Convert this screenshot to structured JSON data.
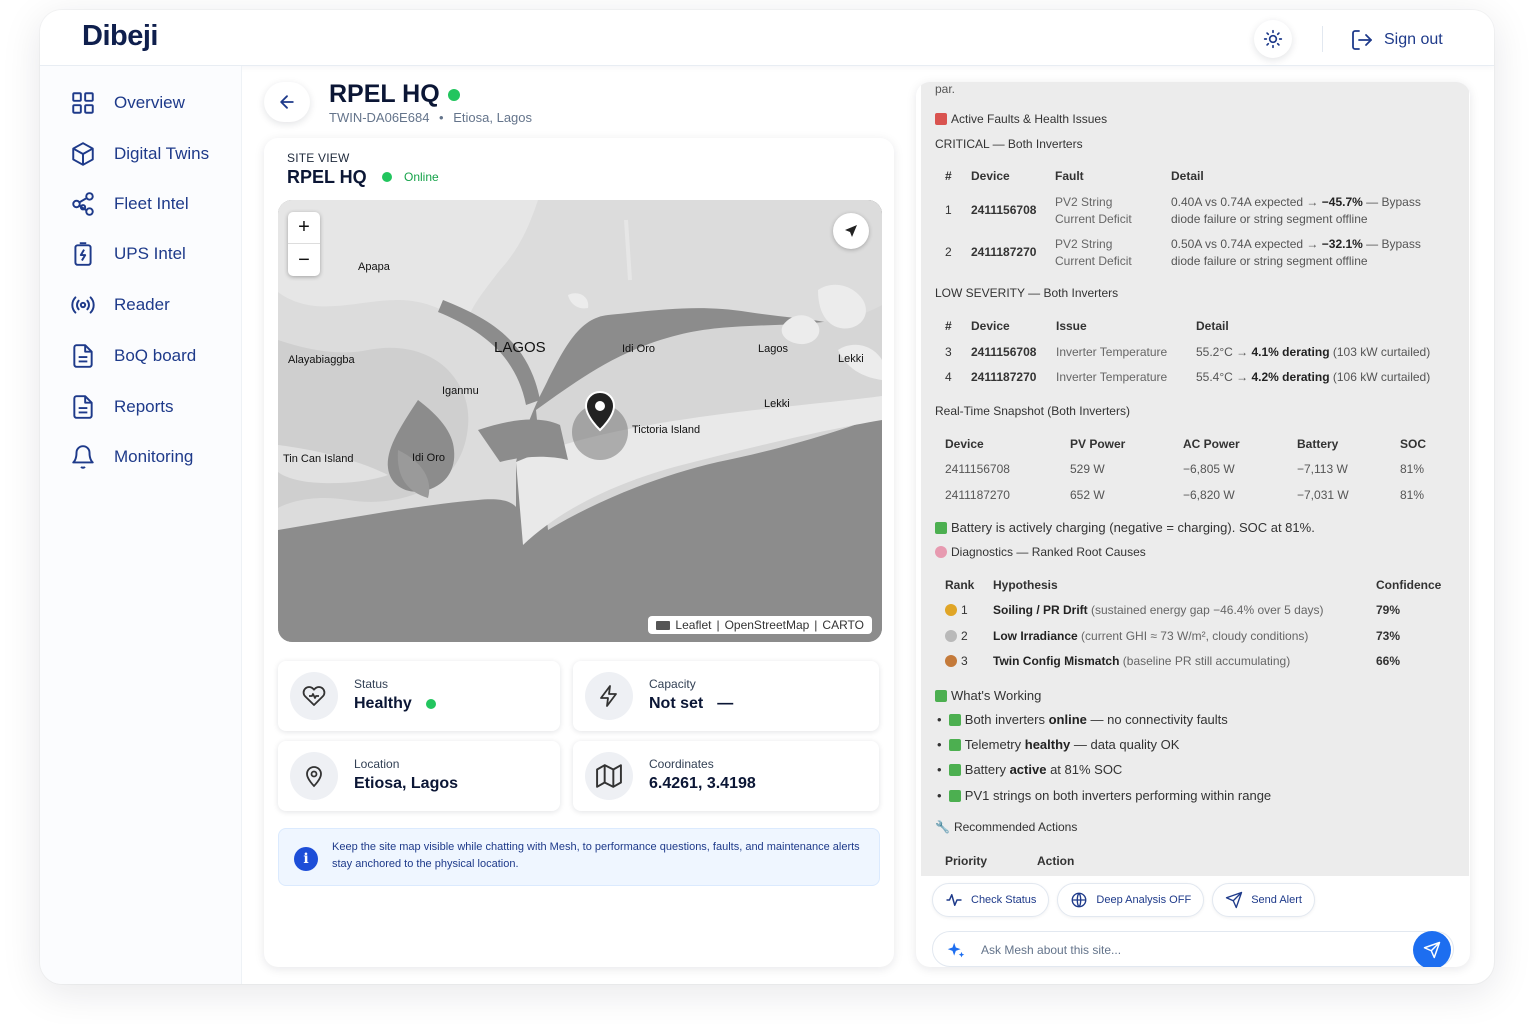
{
  "app": {
    "logo": "Dibeji",
    "sign_out": "Sign out"
  },
  "sidebar": {
    "items": [
      {
        "label": "Overview",
        "icon": "grid-icon"
      },
      {
        "label": "Digital Twins",
        "icon": "cube-icon"
      },
      {
        "label": "Fleet Intel",
        "icon": "network-icon"
      },
      {
        "label": "UPS Intel",
        "icon": "battery-bolt-icon"
      },
      {
        "label": "Reader",
        "icon": "broadcast-icon"
      },
      {
        "label": "BoQ board",
        "icon": "document-icon"
      },
      {
        "label": "Reports",
        "icon": "document-icon"
      },
      {
        "label": "Monitoring",
        "icon": "bell-icon"
      }
    ]
  },
  "header": {
    "title": "RPEL HQ",
    "twin_id": "TWIN-DA06E684",
    "separator": "•",
    "location": "Etiosa, Lagos"
  },
  "site": {
    "label": "SITE VIEW",
    "title": "RPEL HQ",
    "status": "Online",
    "map": {
      "attribution": {
        "leaflet": "Leaflet",
        "sep": "|",
        "osm": "OpenStreetMap",
        "carto": "CARTO"
      },
      "labels": [
        "Apapa",
        "LAGOS",
        "Idi Oro",
        "Lagos",
        "Lekki",
        "Alayabiaggba",
        "Iganmu",
        "Lekki",
        "Tictoria Island",
        "Tin Can Island",
        "Idi Oro"
      ]
    },
    "tiles": {
      "status": {
        "label": "Status",
        "value": "Healthy"
      },
      "capacity": {
        "label": "Capacity",
        "value": "Not set",
        "dash": "—"
      },
      "location": {
        "label": "Location",
        "value": "Etiosa, Lagos"
      },
      "coordinates": {
        "label": "Coordinates",
        "value": "6.4261, 3.4198"
      }
    },
    "info": "Keep the site map visible while chatting with Mesh, to performance questions, faults, and maintenance alerts stay anchored to the physical location."
  },
  "chat": {
    "cut_top": "par.",
    "faults_heading": "Active Faults & Health Issues",
    "critical_heading": "CRITICAL — Both Inverters",
    "critical_headers": [
      "#",
      "Device",
      "Fault",
      "Detail"
    ],
    "critical_rows": [
      {
        "n": "1",
        "device": "2411156708",
        "fault1": "PV2 String",
        "fault2": "Current Deficit",
        "d1": "0.40A vs 0.74A expected → ",
        "d_bold": "−45.7%",
        "d2": " — Bypass",
        "d3": "diode failure or string segment offline"
      },
      {
        "n": "2",
        "device": "2411187270",
        "fault1": "PV2 String",
        "fault2": "Current Deficit",
        "d1": "0.50A vs 0.74A expected → ",
        "d_bold": "−32.1%",
        "d2": " — Bypass",
        "d3": "diode failure or string segment offline"
      }
    ],
    "low_heading": "LOW SEVERITY — Both Inverters",
    "low_headers": [
      "#",
      "Device",
      "Issue",
      "Detail"
    ],
    "low_rows": [
      {
        "n": "3",
        "device": "2411156708",
        "issue": "Inverter Temperature",
        "d1": "55.2°C → ",
        "d_bold": "4.1% derating",
        "d2": " (103 kW curtailed)"
      },
      {
        "n": "4",
        "device": "2411187270",
        "issue": "Inverter Temperature",
        "d1": "55.4°C → ",
        "d_bold": "4.2% derating",
        "d2": " (106 kW curtailed)"
      }
    ],
    "snapshot_heading": "Real-Time Snapshot (Both Inverters)",
    "snapshot_headers": [
      "Device",
      "PV Power",
      "AC Power",
      "Battery",
      "SOC"
    ],
    "snapshot_rows": [
      [
        "2411156708",
        "529 W",
        "−6,805 W",
        "−7,113 W",
        "81%"
      ],
      [
        "2411187270",
        "652 W",
        "−6,820 W",
        "−7,031 W",
        "81%"
      ]
    ],
    "battery_note": "Battery is actively charging (negative = charging). SOC at 81%.",
    "diagnostics_heading": "Diagnostics — Ranked Root Causes",
    "diag_headers": [
      "Rank",
      "Hypothesis",
      "Confidence"
    ],
    "diag_rows": [
      {
        "rank": "1",
        "bold": "Soiling / PR Drift",
        "rest": " (sustained energy gap −46.4% over 5 days)",
        "conf": "79%",
        "medal": "#e0a526"
      },
      {
        "rank": "2",
        "bold": "Low Irradiance",
        "rest": " (current GHI ≈ 73 W/m², cloudy conditions)",
        "conf": "73%",
        "medal": "#b9b9b9"
      },
      {
        "rank": "3",
        "bold": "Twin Config Mismatch",
        "rest": " (baseline PR still accumulating)",
        "conf": "66%",
        "medal": "#c47a3a"
      }
    ],
    "working_heading": "What's Working",
    "working": [
      {
        "pre": "Both inverters ",
        "bold": "online",
        "post": " — no connectivity faults"
      },
      {
        "pre": "Telemetry ",
        "bold": "healthy",
        "post": " — data quality OK"
      },
      {
        "pre": "Battery ",
        "bold": "active",
        "post": " at 81% SOC"
      },
      {
        "pre": "PV1 strings on both inverters performing within range",
        "bold": "",
        "post": ""
      }
    ],
    "actions_heading": "Recommended Actions",
    "actions_headers": [
      "Priority",
      "Action"
    ],
    "chips": [
      "Check Status",
      "Deep Analysis OFF",
      "Send Alert"
    ],
    "input_placeholder": "Ask Mesh about this site..."
  },
  "colors": {
    "accent": "#1d6ef0",
    "navy": "#1e3a8a",
    "online": "#22c55e"
  }
}
